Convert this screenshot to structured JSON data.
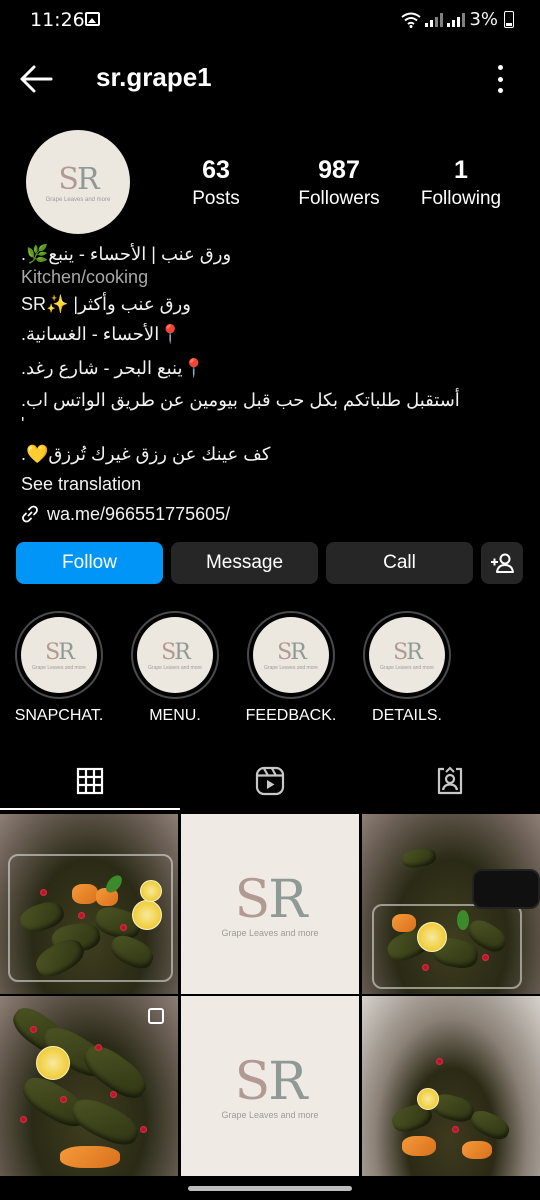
{
  "status_bar": {
    "time": "11:26",
    "battery": "3%"
  },
  "header": {
    "username": "sr.grape1"
  },
  "profile": {
    "avatar_logo": {
      "mark_left": "S",
      "mark_right": "R",
      "tagline": "Grape Leaves and more"
    },
    "stats": [
      {
        "value": "63",
        "label": "Posts"
      },
      {
        "value": "987",
        "label": "Followers"
      },
      {
        "value": "1",
        "label": "Following"
      }
    ],
    "bio": {
      "line1": "ورق عنب | الأحساء - ينبع🌿.",
      "category": "Kitchen/cooking",
      "line2": "SR✨  |ورق عنب وأكثر",
      "line3": "📍الأحساء - الغسانية.",
      "line4": "📍ينبع البحر - شارع رغد.",
      "line5": "أستقبل طلباتكم بكل حب قبل بيومين عن طريق الواتس اب.",
      "line6": "'",
      "line7": "كف عينك عن رزق غيرك تُرزق💛.",
      "see_translation": "See translation",
      "link": "wa.me/966551775605/"
    }
  },
  "actions": {
    "follow": "Follow",
    "message": "Message",
    "call": "Call"
  },
  "highlights": [
    {
      "label": "SNAPCHAT."
    },
    {
      "label": "MENU."
    },
    {
      "label": "FEEDBACK."
    },
    {
      "label": "DETAILS."
    }
  ],
  "grid_logo": {
    "mark_left": "S",
    "mark_right": "R",
    "tagline": "Grape Leaves and more"
  },
  "icons": {
    "back": "arrow-left-icon",
    "more": "more-vertical-icon",
    "add_person": "add-person-icon",
    "grid": "grid-icon",
    "reels": "reels-icon",
    "tagged": "tagged-icon",
    "link": "link-icon"
  },
  "colors": {
    "follow_button": "#0095f6",
    "secondary_button": "#262626",
    "background": "#000000",
    "logo_background": "#ede8df"
  }
}
